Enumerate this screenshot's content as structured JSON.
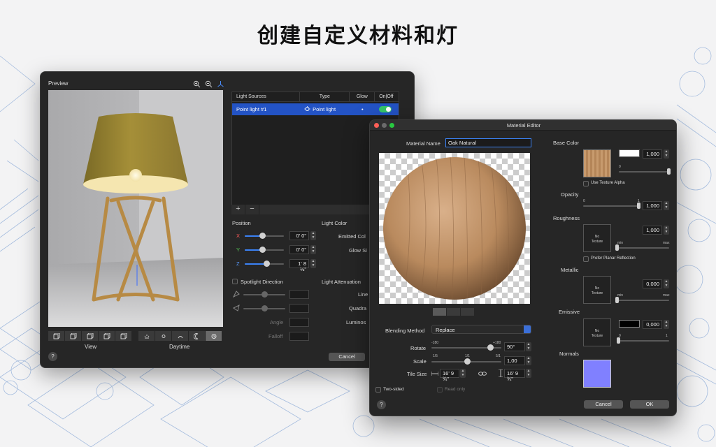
{
  "headline": "创建自定义材料和灯",
  "preview_window": {
    "title": "Preview",
    "view_label": "View",
    "daytime_label": "Daytime",
    "help": "?",
    "cancel_label": "Cancel",
    "light_table": {
      "headers": [
        "Light Sources",
        "Type",
        "Glow",
        "On|Off"
      ],
      "row": {
        "name": "Point light #1",
        "type": "Point light",
        "glow": "•",
        "on": true
      }
    },
    "add_symbol": "+",
    "remove_symbol": "−",
    "position_label": "Position",
    "axes": [
      {
        "label": "X",
        "value": "0' 0\"",
        "color": "#ff5a5a",
        "level": 0.45
      },
      {
        "label": "Y",
        "value": "0' 0\"",
        "color": "#5ad45a",
        "level": 0.45
      },
      {
        "label": "Z",
        "value": "1' 8 ½\"",
        "color": "#5a9bff",
        "level": 0.55
      }
    ],
    "spotlight_label": "Spotlight Direction",
    "angle_label": "Angle",
    "falloff_label": "Falloff",
    "light_color_label": "Light Color",
    "emitted_label": "Emitted Col",
    "glow_size_label": "Glow Si",
    "attenuation_label": "Light Attenuation",
    "linear_label": "Line",
    "quadratic_label": "Quadra",
    "luminosity_label": "Luminos"
  },
  "material_editor": {
    "title": "Material Editor",
    "name_label": "Material Name",
    "name_value": "Oak Natural",
    "blending_label": "Blending Method",
    "blending_value": "Replace",
    "rotate": {
      "label": "Rotate",
      "min": "-180",
      "max": "+180",
      "value": "90°",
      "level": 0.83
    },
    "scale": {
      "label": "Scale",
      "min": "1/5",
      "mid": "1/1",
      "max": "5/1",
      "value": "1,00",
      "level": 0.5
    },
    "tile_label": "Tile Size",
    "tile_w": "16' 9 ¾\"",
    "tile_h": "16' 9 ¾\"",
    "two_sided_label": "Two-sided",
    "read_only_label": "Read only",
    "help": "?",
    "cancel_label": "Cancel",
    "ok_label": "OK",
    "base_color": {
      "label": "Base Color",
      "value": "1,000",
      "min": "0",
      "level": 1.0,
      "alpha_label": "Use Texture Alpha"
    },
    "opacity": {
      "label": "Opacity",
      "value": "1,000",
      "min": "0",
      "max": "1",
      "level": 1.0
    },
    "roughness": {
      "label": "Roughness",
      "value": "1,000",
      "min": "min",
      "max": "max",
      "no_texture": "No\nTexture",
      "planar_label": "Prefer Planar Reflection",
      "level": 0.0
    },
    "metallic": {
      "label": "Metallic",
      "value": "0,000",
      "min": "min",
      "max": "max",
      "no_texture": "No\nTexture",
      "level": 0.0
    },
    "emissive": {
      "label": "Emissive",
      "value": "0,000",
      "min": "0",
      "max": "1",
      "no_texture": "No\nTexture",
      "level": 0.0
    },
    "normals": {
      "label": "Normals"
    }
  }
}
